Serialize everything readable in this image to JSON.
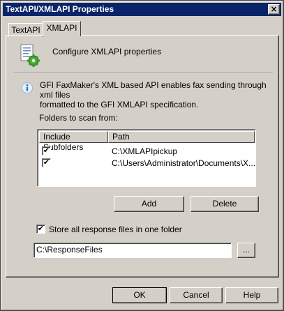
{
  "window": {
    "title": "TextAPI/XMLAPI Properties",
    "close_glyph": "×"
  },
  "tabs": [
    {
      "label": "TextAPI",
      "active": false
    },
    {
      "label": "XMLAPI",
      "active": true
    }
  ],
  "xmlapi": {
    "header_text": "Configure XMLAPI properties",
    "info_text_line1": "GFI FaxMaker's XML based API enables fax sending through xml files",
    "info_text_line2": "formatted to the GFI XMLAPI specification.",
    "folders_label": "Folders to scan from:",
    "columns": [
      "Include Subfolders",
      "Path"
    ],
    "rows": [
      {
        "include_subfolders": true,
        "path": "C:\\XMLAPIpickup"
      },
      {
        "include_subfolders": true,
        "path": "C:\\Users\\Administrator\\Documents\\X..."
      }
    ],
    "add_label": "Add",
    "delete_label": "Delete",
    "store_checkbox_label": "Store all response files in one folder",
    "store_checked": true,
    "response_folder_value": "C:\\ResponseFiles",
    "browse_label": "..."
  },
  "footer": {
    "ok_label": "OK",
    "cancel_label": "Cancel",
    "help_label": "Help"
  },
  "icons": {
    "properties_icon": "document-gear-icon",
    "info_icon": "info-icon",
    "check_glyph": "✔"
  },
  "colors": {
    "titlebar": "#0a246a",
    "face": "#d4d0c8",
    "info_blue": "#2a6fc9",
    "gear_green": "#3a9a2a"
  }
}
